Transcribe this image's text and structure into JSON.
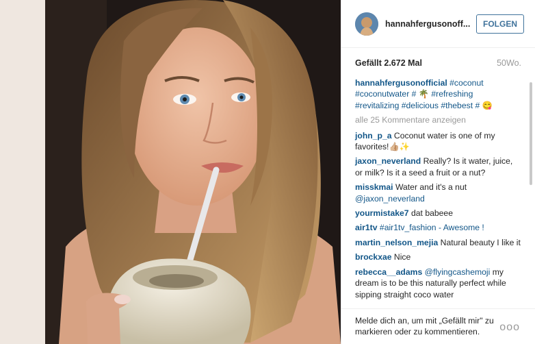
{
  "post": {
    "username": "hannahfergusonoff...",
    "follow_label": "FOLGEN",
    "likes": "Gefällt 2.672 Mal",
    "age": "50Wo.",
    "caption": {
      "user": "hannahfergusonofficial",
      "tags_line1": "#coconut",
      "tags_line2": "#coconutwater # 🌴 #refreshing",
      "tags_line3": "#revitalizing #delicious #thebest # 😋"
    },
    "load_more": "alle 25 Kommentare anzeigen",
    "comments": [
      {
        "user": "john_p_a",
        "text": "Coconut water is one of my favorites!👍🏼✨"
      },
      {
        "user": "jaxon_neverland",
        "text": "Really? Is it water, juice, or milk? Is it a seed a fruit or a nut?"
      },
      {
        "user": "misskmai",
        "text": "Water and it's a nut",
        "mention": "@jaxon_neverland"
      },
      {
        "user": "yourmistake7",
        "text": "dat babeee"
      },
      {
        "user": "air1tv",
        "text": "#air1tv_fashion - Awesome !"
      },
      {
        "user": "martin_nelson_mejia",
        "text": "Natural beauty I like it"
      },
      {
        "user": "brockxae",
        "text": "Nice"
      },
      {
        "user": "rebecca__adams",
        "mention": "@flyingcashemoji",
        "text": "my dream is to be this naturally perfect while sipping straight coco water"
      }
    ],
    "login_prompt": "Melde dich an, um mit „Gefällt mir\" zu markieren oder zu kommentieren.",
    "options_glyph": "ooo"
  },
  "icons": {
    "avatar": "profile-photo",
    "options": "more-options-icon"
  }
}
